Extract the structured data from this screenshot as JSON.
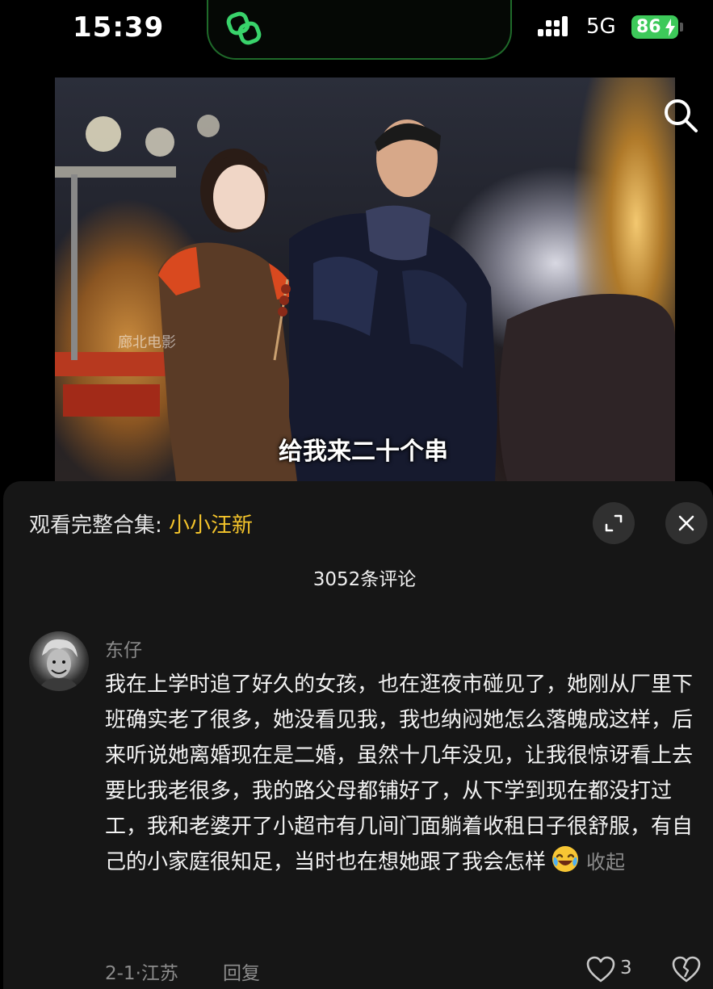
{
  "status_bar": {
    "time": "15:39",
    "network": "5G",
    "battery": "86",
    "island_icon": "link-rings-icon"
  },
  "video": {
    "watermark": "廊北电影",
    "subtitle": "给我来二十个串",
    "search_icon": "search-icon"
  },
  "sheet": {
    "collection_prefix": "观看完整合集: ",
    "collection_name": "小小汪新",
    "comment_count": "3052条评论",
    "expand_icon": "expand-icon",
    "close_icon": "close-icon"
  },
  "comment": {
    "username": "东仔",
    "text": "我在上学时追了好久的女孩，也在逛夜市碰见了，她刚从厂里下班确实老了很多，她没看见我，我也纳闷她怎么落魄成这样，后来听说她离婚现在是二婚，虽然十几年没见，让我很惊讶看上去要比我老很多，我的路父母都铺好了，从下学到现在都没打过工，我和老婆开了小超市有几间门面躺着收租日子很舒服，有自己的小家庭很知足，当时也在想她跟了我会怎样",
    "emoji": "laughing-crying-emoji",
    "collapse_label": "收起",
    "meta": "2-1·江苏",
    "reply_label": "回复",
    "like_count": "3"
  },
  "colors": {
    "accent_gold": "#f4c42b",
    "battery_green": "#3dc95a",
    "sheet_bg": "#161616"
  }
}
